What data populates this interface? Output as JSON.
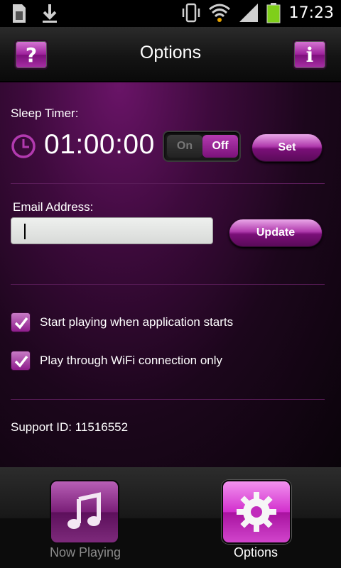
{
  "status_bar": {
    "time": "17:23",
    "icons": [
      "sim-card-icon",
      "download-icon",
      "vibrate-icon",
      "wifi-icon",
      "signal-icon",
      "battery-icon"
    ]
  },
  "header": {
    "title": "Options",
    "help_label": "?",
    "info_label": "i"
  },
  "sleep_timer": {
    "label": "Sleep Timer:",
    "time": "01:00:00",
    "toggle_on": "On",
    "toggle_off": "Off",
    "toggle_state": "off",
    "set_label": "Set"
  },
  "email": {
    "label": "Email Address:",
    "value": "",
    "update_label": "Update"
  },
  "checkboxes": [
    {
      "label": "Start playing when application starts",
      "checked": true
    },
    {
      "label": "Play through WiFi connection only",
      "checked": true
    }
  ],
  "support": {
    "text": "Support ID: 11516552"
  },
  "bottom_nav": {
    "items": [
      {
        "label": "Now Playing",
        "icon": "music-note-icon",
        "active": false
      },
      {
        "label": "Options",
        "icon": "gear-icon",
        "active": true
      }
    ]
  },
  "colors": {
    "accent": "#a31e9f",
    "background": "#000000"
  }
}
